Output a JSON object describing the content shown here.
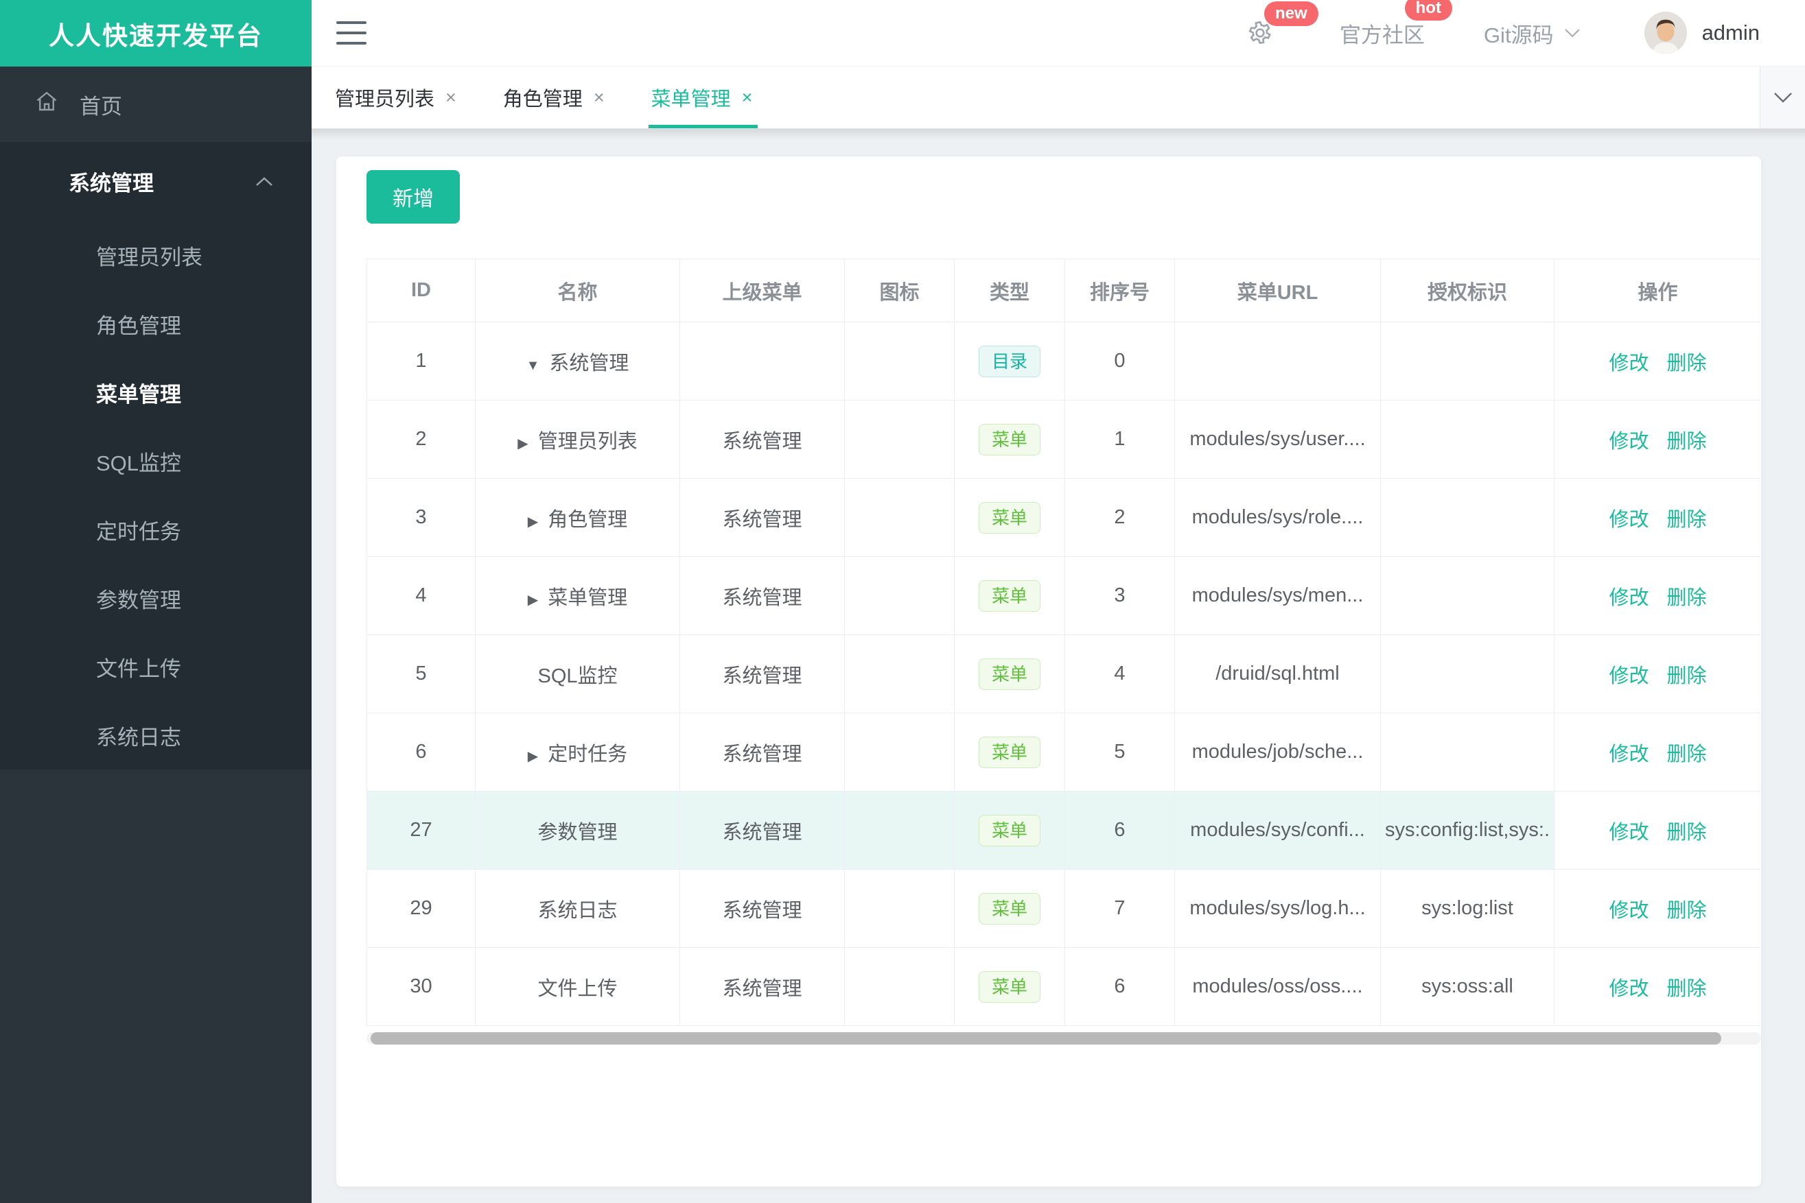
{
  "app": {
    "title": "人人快速开发平台"
  },
  "topbar": {
    "community_label": "官方社区",
    "git_label": "Git源码",
    "username": "admin",
    "badge_new": "new",
    "badge_hot": "hot"
  },
  "tabs": [
    {
      "label": "管理员列表",
      "close": "×",
      "active": false
    },
    {
      "label": "角色管理",
      "close": "×",
      "active": false
    },
    {
      "label": "菜单管理",
      "close": "×",
      "active": true
    }
  ],
  "sidebar": {
    "home_label": "首页",
    "group_label": "系统管理",
    "items": [
      "管理员列表",
      "角色管理",
      "菜单管理",
      "SQL监控",
      "定时任务",
      "参数管理",
      "文件上传",
      "系统日志"
    ],
    "active_item": "菜单管理"
  },
  "toolbar": {
    "add_label": "新增"
  },
  "table": {
    "headers": [
      "ID",
      "名称",
      "上级菜单",
      "图标",
      "类型",
      "排序号",
      "菜单URL",
      "授权标识",
      "操作"
    ],
    "actions": {
      "edit": "修改",
      "delete": "删除"
    },
    "arrow_glyphs": {
      "down": "▼",
      "right": "▶"
    },
    "rows": [
      {
        "id": "1",
        "arrow": "down",
        "name": "系统管理",
        "parent": "",
        "icon": "",
        "type": "目录",
        "type_kind": "dir",
        "order": "0",
        "url": "",
        "perm": "",
        "highlight": false
      },
      {
        "id": "2",
        "arrow": "right",
        "name": "管理员列表",
        "parent": "系统管理",
        "icon": "",
        "type": "菜单",
        "type_kind": "menu",
        "order": "1",
        "url": "modules/sys/user....",
        "perm": "",
        "highlight": false
      },
      {
        "id": "3",
        "arrow": "right",
        "name": "角色管理",
        "parent": "系统管理",
        "icon": "",
        "type": "菜单",
        "type_kind": "menu",
        "order": "2",
        "url": "modules/sys/role....",
        "perm": "",
        "highlight": false
      },
      {
        "id": "4",
        "arrow": "right",
        "name": "菜单管理",
        "parent": "系统管理",
        "icon": "",
        "type": "菜单",
        "type_kind": "menu",
        "order": "3",
        "url": "modules/sys/men...",
        "perm": "",
        "highlight": false
      },
      {
        "id": "5",
        "arrow": "",
        "name": "SQL监控",
        "parent": "系统管理",
        "icon": "",
        "type": "菜单",
        "type_kind": "menu",
        "order": "4",
        "url": "/druid/sql.html",
        "perm": "",
        "highlight": false
      },
      {
        "id": "6",
        "arrow": "right",
        "name": "定时任务",
        "parent": "系统管理",
        "icon": "",
        "type": "菜单",
        "type_kind": "menu",
        "order": "5",
        "url": "modules/job/sche...",
        "perm": "",
        "highlight": false
      },
      {
        "id": "27",
        "arrow": "",
        "name": "参数管理",
        "parent": "系统管理",
        "icon": "",
        "type": "菜单",
        "type_kind": "menu",
        "order": "6",
        "url": "modules/sys/confi...",
        "perm": "sys:config:list,sys:.",
        "highlight": true
      },
      {
        "id": "29",
        "arrow": "",
        "name": "系统日志",
        "parent": "系统管理",
        "icon": "",
        "type": "菜单",
        "type_kind": "menu",
        "order": "7",
        "url": "modules/sys/log.h...",
        "perm": "sys:log:list",
        "highlight": false
      },
      {
        "id": "30",
        "arrow": "",
        "name": "文件上传",
        "parent": "系统管理",
        "icon": "",
        "type": "菜单",
        "type_kind": "menu",
        "order": "6",
        "url": "modules/oss/oss....",
        "perm": "sys:oss:all",
        "highlight": false
      }
    ]
  },
  "colors": {
    "accent": "#1abc9c",
    "sidebar_bg": "#2b343b",
    "sidebar_submenu_bg": "#232c32",
    "badge_red": "#f7686d",
    "tag_dir_text": "#17b3a3",
    "tag_menu_text": "#60c13d",
    "row_highlight": "#e8f6f4",
    "table_border": "#ebeef5"
  }
}
